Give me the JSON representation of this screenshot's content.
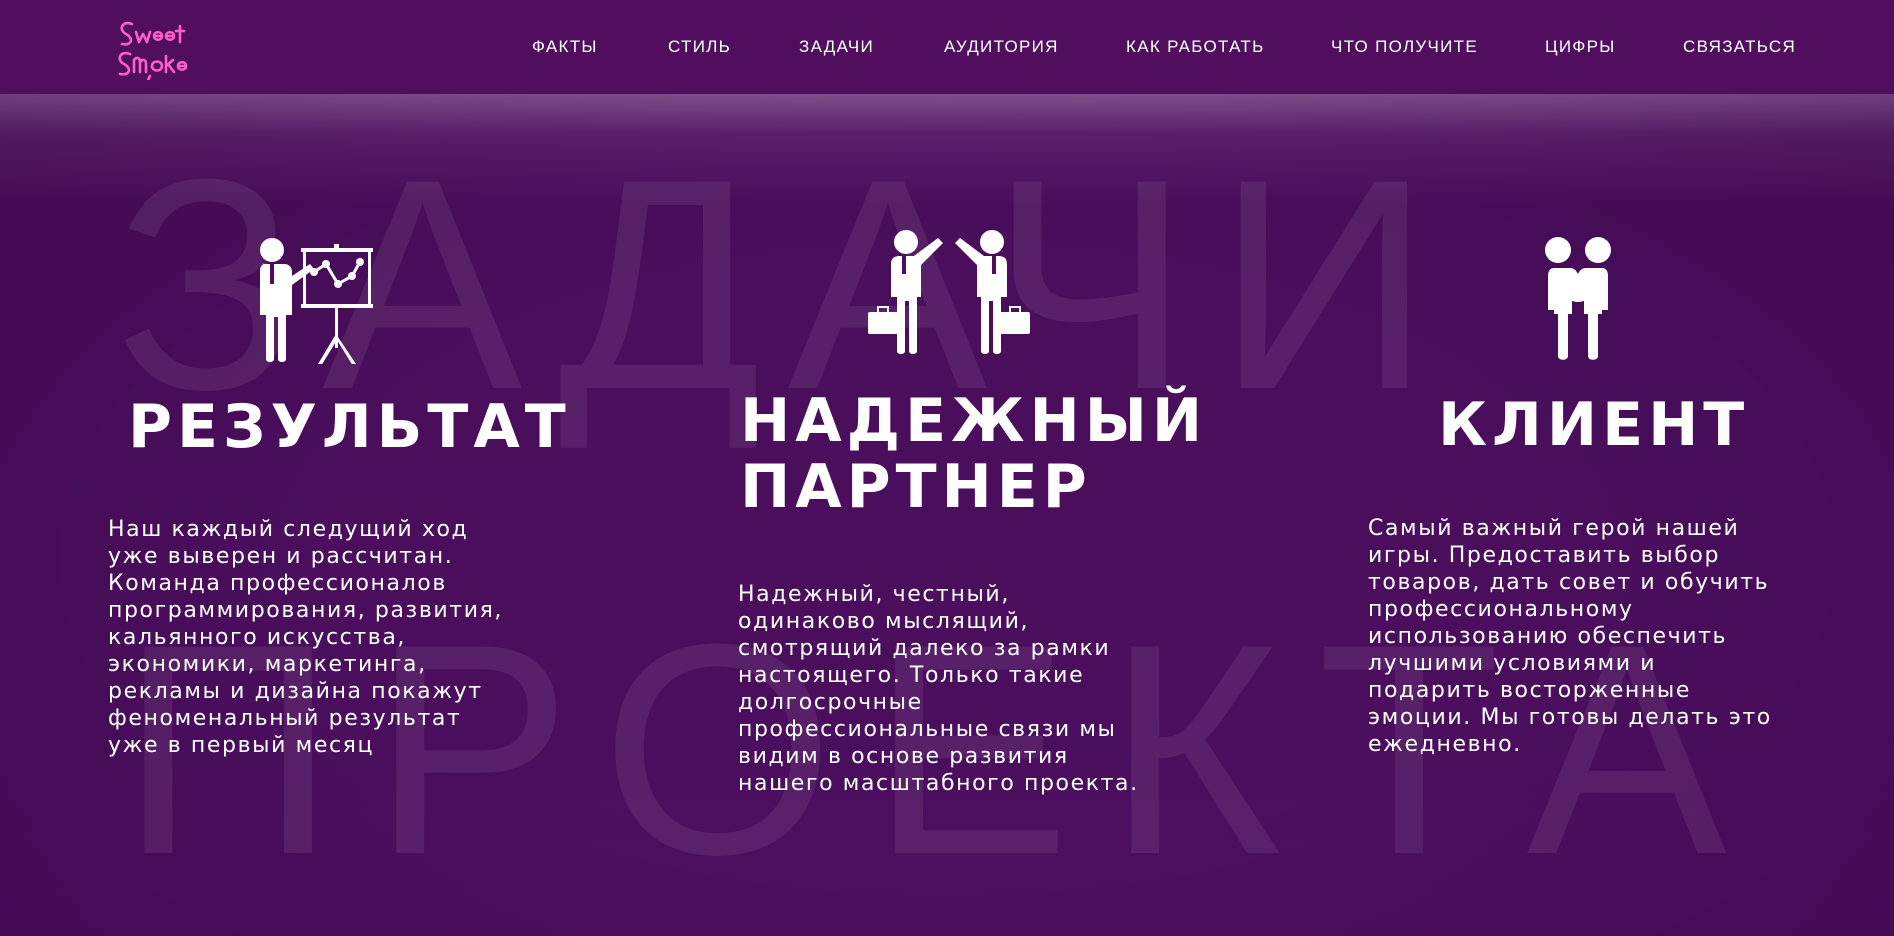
{
  "nav": {
    "logo_text": "Sweet Smoke",
    "items": [
      {
        "label": "ФАКТЫ"
      },
      {
        "label": "СТИЛЬ"
      },
      {
        "label": "ЗАДАЧИ"
      },
      {
        "label": "АУДИТОРИЯ"
      },
      {
        "label": "КАК РАБОТАТЬ"
      },
      {
        "label": "ЧТО ПОЛУЧИТЕ"
      },
      {
        "label": "ЦИФРЫ"
      },
      {
        "label": "СВЯЗАТЬСЯ"
      }
    ]
  },
  "hero": {
    "background_word_line1": "ЗАДАЧИ",
    "background_word_line2": "ПРОЕКТА",
    "columns": [
      {
        "icon": "presentation-icon",
        "title_lines": [
          "РЕЗУЛЬТАТ"
        ],
        "text_lines": [
          "Наш каждый следущий ход",
          "уже выверен и рассчитан.",
          "Команда профессионалов",
          "программирования, развития,",
          "кальянного искусства,",
          "экономики, маркетинга,",
          "рекламы и дизайна покажут",
          "феноменальный результат",
          "уже в первый месяц"
        ]
      },
      {
        "icon": "high-five-icon",
        "title_lines": [
          "НАДЕЖНЫЙ",
          "ПАРТНЕР"
        ],
        "text_lines": [
          "Надежный, честный,",
          "одинаково мыслящий,",
          "смотрящий далеко за рамки",
          "настоящего. Только такие",
          "долгосрочные",
          "профессиональные связи мы",
          "видим в основе развития",
          "нашего масштабного проекта."
        ]
      },
      {
        "icon": "handshake-icon",
        "title_lines": [
          "КЛИЕНТ"
        ],
        "text_lines": [
          "Самый важный герой нашей",
          "игры. Предоставить выбор",
          "товаров, дать совет и обучить",
          "профессиональному",
          "использованию обеспечить",
          "лучшими условиями и",
          "подарить восторженные",
          "эмоции. Мы готовы делать это",
          "ежедневно."
        ]
      }
    ]
  },
  "colors": {
    "nav_bg": "#510e5f",
    "hero_bg": "#4a0e5c",
    "logo_pink": "#ff5fc8",
    "text": "#ffffff"
  }
}
